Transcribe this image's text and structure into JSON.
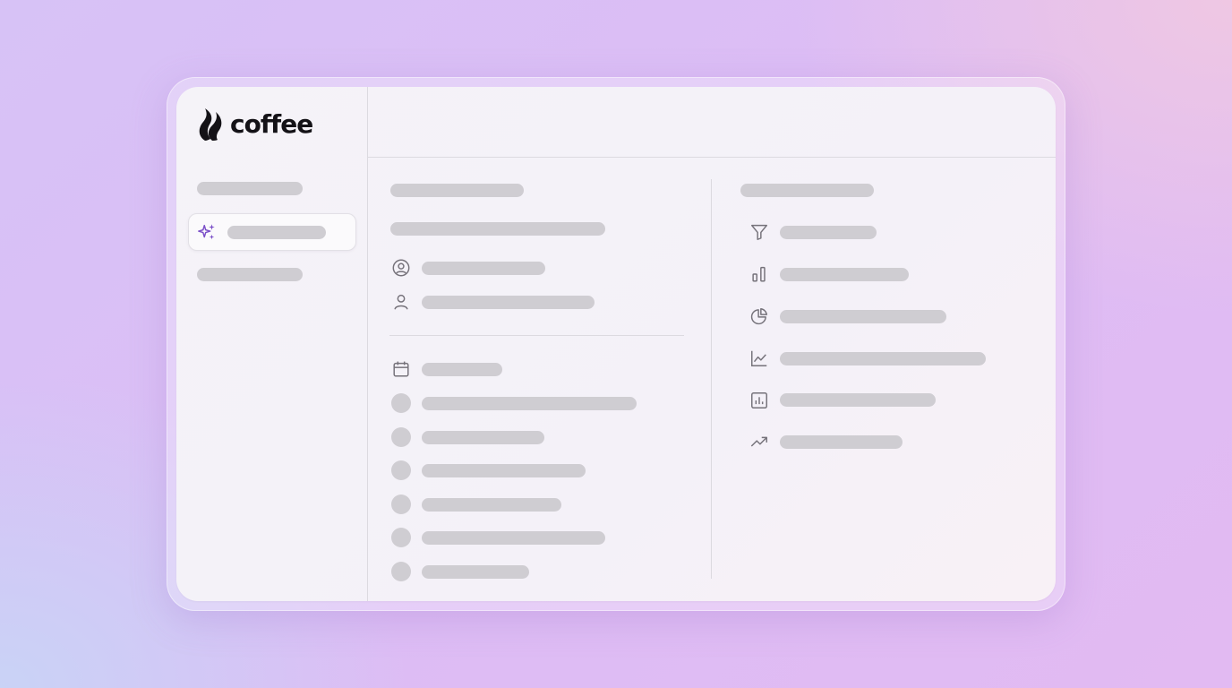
{
  "app": {
    "name": "coffee"
  },
  "colors": {
    "accent": "#7b4fc8",
    "placeholder": "#cfcdd2",
    "icon": "#75727a"
  },
  "sidebar": {
    "items": [
      {
        "name": "nav-placeholder-1",
        "active": false
      },
      {
        "name": "nav-ai",
        "icon": "sparkles-icon",
        "active": true
      },
      {
        "name": "nav-placeholder-3",
        "active": false
      }
    ]
  },
  "left_panel": {
    "rows_top": [
      {
        "icon": "user-circle-icon"
      },
      {
        "icon": "user-icon"
      }
    ],
    "rows_bottom": [
      {
        "icon": "calendar-icon"
      },
      {
        "icon": "dot"
      },
      {
        "icon": "dot"
      },
      {
        "icon": "dot"
      },
      {
        "icon": "dot"
      },
      {
        "icon": "dot"
      },
      {
        "icon": "dot"
      }
    ]
  },
  "right_panel": {
    "rows": [
      {
        "icon": "filter-icon"
      },
      {
        "icon": "bar-chart-icon"
      },
      {
        "icon": "pie-chart-icon"
      },
      {
        "icon": "line-chart-icon"
      },
      {
        "icon": "chart-box-icon"
      },
      {
        "icon": "trending-up-icon"
      }
    ]
  }
}
